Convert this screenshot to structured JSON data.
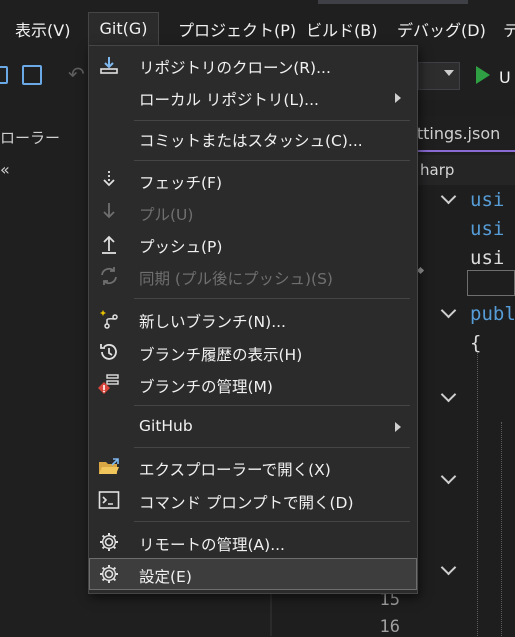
{
  "menubar": {
    "items": [
      {
        "label": "表示(V)"
      },
      {
        "label": "Git(G)"
      },
      {
        "label": "プロジェクト(P)"
      },
      {
        "label": "ビルド(B)"
      },
      {
        "label": "デバッグ(D)"
      },
      {
        "label": "テ"
      }
    ]
  },
  "toolbar": {
    "run_label": "U"
  },
  "left_panel": {
    "title": "ローラー",
    "glyph": "«"
  },
  "editor": {
    "tab_label": "ettings.json",
    "nav_label": "harp",
    "code_lines": [
      {
        "kw": "usi",
        "text": ""
      },
      {
        "kw": "usi",
        "text": ""
      },
      {
        "kw": "",
        "text": "usi"
      },
      {
        "kw": "publ",
        "text": ""
      },
      {
        "kw": "",
        "text": "{"
      }
    ],
    "line_numbers": [
      "15",
      "16"
    ]
  },
  "git_menu": {
    "items": [
      {
        "id": "clone",
        "label": "リポジトリのクローン(R)...",
        "icon": "clone-download-icon",
        "glyph": "⤓",
        "enabled": true,
        "submenu": false
      },
      {
        "id": "local",
        "label": "ローカル リポジトリ(L)...",
        "icon": "",
        "glyph": "",
        "enabled": true,
        "submenu": true
      },
      {
        "id": "commit",
        "label": "コミットまたはスタッシュ(C)...",
        "icon": "",
        "glyph": "",
        "enabled": true,
        "submenu": false
      },
      {
        "id": "fetch",
        "label": "フェッチ(F)",
        "icon": "fetch-icon",
        "glyph": "⇣",
        "enabled": true,
        "submenu": false
      },
      {
        "id": "pull",
        "label": "プル(U)",
        "icon": "pull-icon",
        "glyph": "↓",
        "enabled": false,
        "submenu": false
      },
      {
        "id": "push",
        "label": "プッシュ(P)",
        "icon": "push-icon",
        "glyph": "⭱",
        "enabled": true,
        "submenu": false
      },
      {
        "id": "sync",
        "label": "同期 (プル後にプッシュ)(S)",
        "icon": "sync-icon",
        "glyph": "⟳",
        "enabled": false,
        "submenu": false
      },
      {
        "id": "new-branch",
        "label": "新しいブランチ(N)...",
        "icon": "new-branch-icon",
        "glyph": "⑂",
        "enabled": true,
        "submenu": false
      },
      {
        "id": "branch-history",
        "label": "ブランチ履歴の表示(H)",
        "icon": "history-icon",
        "glyph": "⟲",
        "enabled": true,
        "submenu": false
      },
      {
        "id": "manage-branches",
        "label": "ブランチの管理(M)",
        "icon": "manage-branches-icon",
        "glyph": "",
        "enabled": true,
        "submenu": false
      },
      {
        "id": "github",
        "label": "GitHub",
        "icon": "",
        "glyph": "",
        "enabled": true,
        "submenu": true
      },
      {
        "id": "explorer",
        "label": "エクスプローラーで開く(X)",
        "icon": "folder-open-icon",
        "glyph": "",
        "enabled": true,
        "submenu": false
      },
      {
        "id": "cmd",
        "label": "コマンド プロンプトで開く(D)",
        "icon": "terminal-icon",
        "glyph": "",
        "enabled": true,
        "submenu": false
      },
      {
        "id": "remotes",
        "label": "リモートの管理(A)...",
        "icon": "gear-icon",
        "glyph": "⚙",
        "enabled": true,
        "submenu": false
      },
      {
        "id": "settings",
        "label": "設定(E)",
        "icon": "gear-icon",
        "glyph": "⚙",
        "enabled": true,
        "submenu": false,
        "selected": true
      }
    ]
  },
  "colors": {
    "accent": "#8a6bd4",
    "run_green": "#2ea043",
    "menu_bg": "#2b2b2b",
    "disabled_text": "#6f6f6f"
  }
}
